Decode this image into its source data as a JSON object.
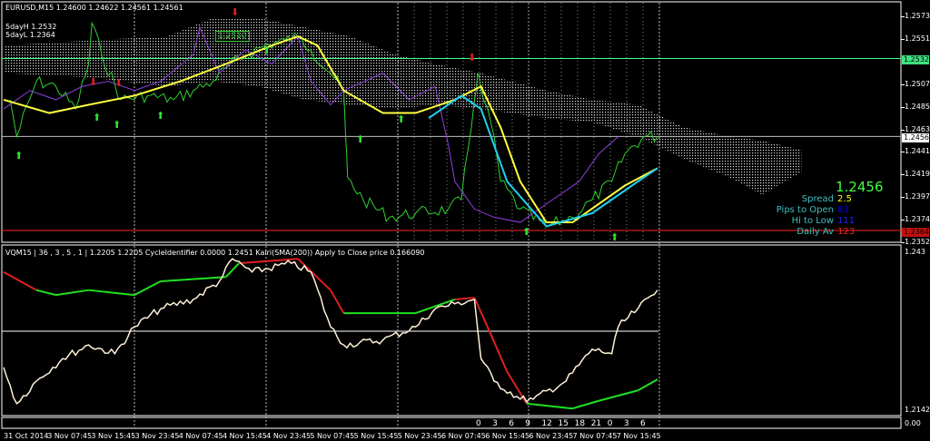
{
  "header": {
    "symbol_line": "EURUSD,M15  1.24600 1.24622 1.24561 1.24561",
    "five_day_high": "5dayH 1.2532",
    "five_day_low": "5dayL 1.2364",
    "level_label": "1.2510"
  },
  "indicator_header": "VQM15 | 36 , 3 , 5 , 1 |  1.2205 1.2205  CycleIdentifier 0.0000 1.2451  Kairi(SMA(200)) Apply to Close price 0.166090",
  "info_panel": {
    "price": "1.2456",
    "rows": [
      {
        "label": "Spread",
        "value": "2.5",
        "color": "#ffff00"
      },
      {
        "label": "Pips to Open",
        "value": "83",
        "color": "#0000ff"
      },
      {
        "label": "Hi to Low",
        "value": "111",
        "color": "#2020ff"
      },
      {
        "label": "Daily Av",
        "value": "123",
        "color": "#ff2020"
      }
    ],
    "label_color": "#40c0c0",
    "price_color": "#40ff40"
  },
  "price_axis": {
    "ticks": [
      "1.25736",
      "1.25515",
      "1.25070",
      "1.24850",
      "1.24630",
      "1.24410",
      "1.24190",
      "1.23970",
      "1.23745",
      "1.23525"
    ],
    "green_box": "1.25323",
    "white_box": "1.24561",
    "red_box": "1.23640"
  },
  "indicator_axis": {
    "top": "1.243",
    "bottom": "1.2142",
    "strip": "0.00"
  },
  "time_axis": [
    "31 Oct 2014",
    "3 Nov 07:45",
    "3 Nov 15:45",
    "3 Nov 23:45",
    "4 Nov 07:45",
    "4 Nov 15:45",
    "4 Nov 23:45",
    "5 Nov 07:45",
    "5 Nov 15:45",
    "5 Nov 23:45",
    "6 Nov 07:45",
    "6 Nov 15:45",
    "6 Nov 23:45",
    "7 Nov 07:45",
    "7 Nov 15:45"
  ],
  "hour_strip": [
    "0",
    "3",
    "6",
    "9",
    "12",
    "15",
    "18",
    "21",
    "0",
    "3",
    "6"
  ],
  "chart_data": {
    "type": "line",
    "title": "EURUSD,M15",
    "ylim": [
      1.23525,
      1.25736
    ],
    "horizontal_levels": [
      {
        "name": "5dayH",
        "value": 1.25323,
        "color": "#40ff80"
      },
      {
        "name": "bid",
        "value": 1.24561,
        "color": "#c0c0c0"
      },
      {
        "name": "5dayL",
        "value": 1.2364,
        "color": "#ff2020"
      }
    ],
    "cloud": {
      "x": [
        0,
        13,
        25,
        32,
        39,
        46,
        53,
        60,
        66,
        73,
        83,
        90,
        97,
        104,
        111,
        116,
        122
      ],
      "top": [
        1.2545,
        1.255,
        1.2554,
        1.2572,
        1.2572,
        1.2563,
        1.2554,
        1.2536,
        1.2527,
        1.2518,
        1.2501,
        1.2492,
        1.2487,
        1.2465,
        1.2456,
        1.2452,
        1.2443
      ],
      "bottom": [
        1.2518,
        1.2514,
        1.2505,
        1.251,
        1.2505,
        1.2492,
        1.2487,
        1.2483,
        1.2487,
        1.2483,
        1.2474,
        1.247,
        1.2456,
        1.2434,
        1.2416,
        1.2399,
        1.2421
      ]
    },
    "series": [
      {
        "name": "price",
        "color": "#30d030",
        "points": [
          [
            1,
            1.2492
          ],
          [
            2,
            1.2456
          ],
          [
            5,
            1.251
          ],
          [
            8,
            1.2505
          ],
          [
            11,
            1.2483
          ],
          [
            13,
            1.2527
          ],
          [
            13.5,
            1.2567
          ],
          [
            15,
            1.2536
          ],
          [
            18,
            1.2492
          ],
          [
            22,
            1.2496
          ],
          [
            26,
            1.2492
          ],
          [
            29,
            1.2501
          ],
          [
            32,
            1.251
          ],
          [
            34,
            1.2523
          ],
          [
            37,
            1.2536
          ],
          [
            40,
            1.2545
          ],
          [
            43,
            1.255
          ],
          [
            45,
            1.2554
          ],
          [
            47,
            1.2541
          ],
          [
            50,
            1.2518
          ],
          [
            52,
            1.2501
          ],
          [
            52.3,
            1.2456
          ],
          [
            52.6,
            1.2416
          ],
          [
            55,
            1.2394
          ],
          [
            59,
            1.2377
          ],
          [
            63,
            1.2381
          ],
          [
            68,
            1.2385
          ],
          [
            70,
            1.2394
          ],
          [
            72,
            1.2492
          ],
          [
            72.5,
            1.2518
          ],
          [
            73,
            1.2501
          ],
          [
            75,
            1.2456
          ],
          [
            76,
            1.2412
          ],
          [
            79,
            1.2385
          ],
          [
            83,
            1.2368
          ],
          [
            87,
            1.2377
          ],
          [
            90,
            1.2394
          ],
          [
            93,
            1.2412
          ],
          [
            95,
            1.2439
          ],
          [
            98,
            1.2456
          ],
          [
            100,
            1.2456
          ]
        ]
      },
      {
        "name": "purple",
        "color": "#9040e0",
        "points": [
          [
            0,
            1.2483
          ],
          [
            4,
            1.2501
          ],
          [
            8,
            1.2492
          ],
          [
            12,
            1.2505
          ],
          [
            16,
            1.251
          ],
          [
            20,
            1.2501
          ],
          [
            24,
            1.251
          ],
          [
            29,
            1.2536
          ],
          [
            30,
            1.2563
          ],
          [
            33,
            1.2518
          ],
          [
            37,
            1.2541
          ],
          [
            41,
            1.2527
          ],
          [
            45,
            1.2554
          ],
          [
            47,
            1.251
          ],
          [
            50,
            1.2487
          ],
          [
            52,
            1.2501
          ],
          [
            58,
            1.2518
          ],
          [
            62,
            1.2492
          ],
          [
            66,
            1.2505
          ],
          [
            68,
            1.2448
          ],
          [
            69,
            1.2412
          ],
          [
            72,
            1.2385
          ],
          [
            75,
            1.2377
          ],
          [
            79,
            1.2372
          ],
          [
            83,
            1.239
          ],
          [
            88,
            1.2412
          ],
          [
            91,
            1.2439
          ],
          [
            94,
            1.2456
          ]
        ]
      },
      {
        "name": "yellow-ma",
        "color": "#ffff40",
        "points": [
          [
            0,
            1.2492
          ],
          [
            7,
            1.2479
          ],
          [
            13,
            1.2487
          ],
          [
            20,
            1.2496
          ],
          [
            27,
            1.251
          ],
          [
            34,
            1.2527
          ],
          [
            41,
            1.2545
          ],
          [
            45,
            1.2554
          ],
          [
            48,
            1.2545
          ],
          [
            52,
            1.2501
          ],
          [
            58,
            1.2479
          ],
          [
            63,
            1.2479
          ],
          [
            69,
            1.2492
          ],
          [
            73,
            1.2505
          ],
          [
            76,
            1.2465
          ],
          [
            79,
            1.2412
          ],
          [
            83,
            1.2372
          ],
          [
            87,
            1.2372
          ],
          [
            91,
            1.239
          ],
          [
            95,
            1.2408
          ],
          [
            100,
            1.2425
          ]
        ]
      },
      {
        "name": "cyan-ma",
        "color": "#20d0f0",
        "points": [
          [
            65,
            1.2474
          ],
          [
            70,
            1.2496
          ],
          [
            73,
            1.2483
          ],
          [
            77,
            1.2412
          ],
          [
            83,
            1.2368
          ],
          [
            90,
            1.2381
          ],
          [
            97,
            1.2412
          ],
          [
            100,
            1.2425
          ]
        ]
      }
    ],
    "indicator": {
      "ylim": [
        1.2142,
        1.243
      ],
      "zero_level": 1.2286,
      "oscillator": {
        "color": "#fff0d8",
        "x": [
          0,
          2,
          5,
          9,
          13,
          17,
          20,
          24,
          29,
          33,
          35,
          38,
          44,
          47,
          50,
          52,
          58,
          63,
          66,
          69,
          72,
          73,
          75,
          79,
          81,
          86,
          90,
          93,
          94,
          97,
          100
        ],
        "values": [
          1.222,
          1.2154,
          1.2195,
          1.2236,
          1.2261,
          1.2245,
          1.2294,
          1.2327,
          1.2344,
          1.2377,
          1.2418,
          1.2394,
          1.241,
          1.2394,
          1.2294,
          1.2261,
          1.227,
          1.2294,
          1.2327,
          1.2336,
          1.2344,
          1.2236,
          1.2195,
          1.2162,
          1.2162,
          1.2195,
          1.2253,
          1.2245,
          1.2294,
          1.2327,
          1.2361
        ]
      },
      "signal": {
        "x": [
          0,
          5,
          8,
          13,
          20,
          24,
          34,
          36,
          45,
          50,
          52,
          63,
          69,
          72,
          74,
          77,
          80,
          87,
          91,
          97,
          100
        ],
        "values": [
          1.2394,
          1.2361,
          1.2352,
          1.2361,
          1.2352,
          1.2377,
          1.2385,
          1.241,
          1.2418,
          1.2361,
          1.2319,
          1.2319,
          1.2344,
          1.2347,
          1.2294,
          1.2212,
          1.2154,
          1.2145,
          1.2159,
          1.2178,
          1.2198
        ],
        "trend": [
          "dn",
          "dn",
          "up",
          "up",
          "up",
          "up",
          "up",
          "up",
          "dn",
          "dn",
          "dn",
          "up",
          "up",
          "dn",
          "dn",
          "dn",
          "dn",
          "up",
          "up",
          "up",
          "up"
        ],
        "up_color": "#20e020",
        "down_color": "#e02020"
      }
    }
  }
}
